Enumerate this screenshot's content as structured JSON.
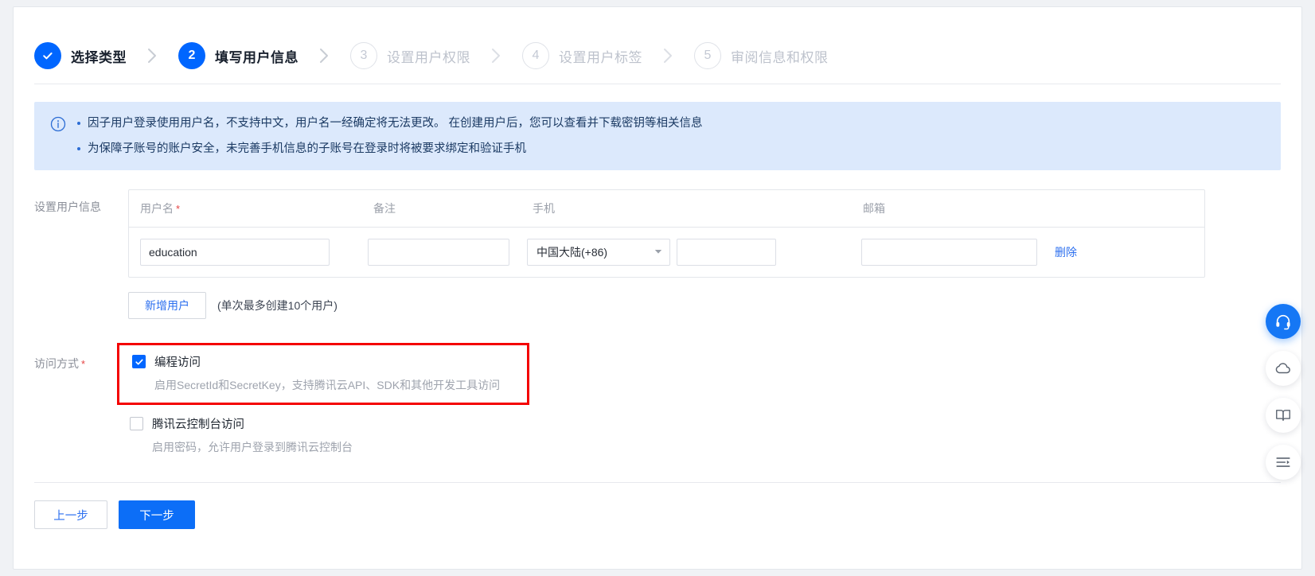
{
  "stepper": {
    "steps": [
      {
        "num": "1",
        "label": "选择类型",
        "state": "done"
      },
      {
        "num": "2",
        "label": "填写用户信息",
        "state": "active"
      },
      {
        "num": "3",
        "label": "设置用户权限",
        "state": "todo"
      },
      {
        "num": "4",
        "label": "设置用户标签",
        "state": "todo"
      },
      {
        "num": "5",
        "label": "审阅信息和权限",
        "state": "todo"
      }
    ]
  },
  "alert": {
    "icon": "info-circle-icon",
    "lines": [
      "因子用户登录使用用户名，不支持中文，用户名一经确定将无法更改。 在创建用户后，您可以查看并下载密钥等相关信息",
      "为保障子账号的账户安全，未完善手机信息的子账号在登录时将被要求绑定和验证手机"
    ]
  },
  "user_info": {
    "section_label": "设置用户信息",
    "columns": {
      "username": "用户名",
      "username_required": "*",
      "remark": "备注",
      "phone": "手机",
      "email": "邮箱"
    },
    "row": {
      "username_value": "education",
      "username_placeholder": "",
      "remark_value": "",
      "remark_placeholder": "",
      "country_code": "中国大陆(+86)",
      "phone_value": "",
      "phone_placeholder": "",
      "email_value": "",
      "email_placeholder": "",
      "delete_label": "删除"
    },
    "add_user_label": "新增用户",
    "add_user_hint": "(单次最多创建10个用户)"
  },
  "access": {
    "section_label": "访问方式",
    "section_required": "*",
    "programmatic": {
      "label": "编程访问",
      "desc": "启用SecretId和SecretKey，支持腾讯云API、SDK和其他开发工具访问",
      "checked": true
    },
    "console": {
      "label": "腾讯云控制台访问",
      "desc": "启用密码，允许用户登录到腾讯云控制台",
      "checked": false
    },
    "highlight_color": "#f40000"
  },
  "footer": {
    "prev_label": "上一步",
    "next_label": "下一步"
  },
  "rail": {
    "items": [
      {
        "name": "support-headset-icon",
        "primary": true
      },
      {
        "name": "cloud-icon",
        "primary": false
      },
      {
        "name": "docs-book-icon",
        "primary": false
      },
      {
        "name": "task-list-icon",
        "primary": false
      }
    ]
  },
  "colors": {
    "accent": "#0066ff",
    "link": "#2c6fef",
    "alert_bg": "#dce9fc",
    "danger": "#e54545"
  }
}
